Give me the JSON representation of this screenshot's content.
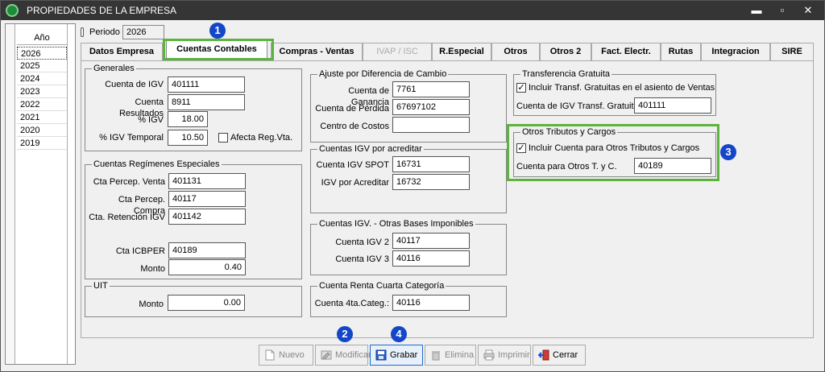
{
  "window": {
    "title": "PROPIEDADES DE LA EMPRESA",
    "min": "▬",
    "max": "▫",
    "close": "✕"
  },
  "years": {
    "header": "Año",
    "items": [
      "2026",
      "2025",
      "2024",
      "2023",
      "2022",
      "2021",
      "2020",
      "2019"
    ],
    "selected": "2026"
  },
  "period": {
    "label": "Periodo",
    "value": "2026"
  },
  "tabs": [
    "Datos Empresa",
    "Cuentas Contables",
    "Compras - Ventas",
    "IVAP / ISC",
    "R.Especial",
    "Otros",
    "Otros 2",
    "Fact. Electr.",
    "Rutas",
    "Integracion",
    "SIRE"
  ],
  "generales": {
    "title": "Generales",
    "cuenta_igv_label": "Cuenta de IGV",
    "cuenta_igv": "401111",
    "cuenta_res_label": "Cuenta Resultados",
    "cuenta_res": "8911",
    "pct_igv_label": "% IGV",
    "pct_igv": "18.00",
    "pct_igv_temp_label": "% IGV Temporal",
    "pct_igv_temp": "10.50",
    "afecta_label": "Afecta Reg.Vta."
  },
  "especiales": {
    "title": "Cuentas Regímenes Especiales",
    "percep_venta_label": "Cta Percep. Venta",
    "percep_venta": "401131",
    "percep_compra_label": "Cta Percep. Compra",
    "percep_compra": "40117",
    "retencion_label": "Cta. Retención IGV",
    "retencion": "401142",
    "icbper_label": "Cta ICBPER",
    "icbper": "40189",
    "monto_label": "Monto",
    "monto": "0.40"
  },
  "uit": {
    "title": "UIT",
    "monto_label": "Monto",
    "monto": "0.00"
  },
  "ajuste": {
    "title": "Ajuste por Diferencia de Cambio",
    "ganancia_label": "Cuenta de Ganancia",
    "ganancia": "7761",
    "perdida_label": "Cuenta de Pérdida",
    "perdida": "67697102",
    "costos_label": "Centro de Costos",
    "costos": ""
  },
  "igv_acreditar": {
    "title": "Cuentas IGV por acreditar",
    "spot_label": "Cuenta IGV SPOT",
    "spot": "16731",
    "acreditar_label": "IGV por Acreditar",
    "acreditar": "16732"
  },
  "otras_bases": {
    "title": "Cuentas IGV. - Otras Bases Imponibles",
    "igv2_label": "Cuenta IGV 2",
    "igv2": "40117",
    "igv3_label": "Cuenta IGV 3",
    "igv3": "40116"
  },
  "renta_cuarta": {
    "title": "Cuenta Renta Cuarta Categoría",
    "cuenta_label": "Cuenta 4ta.Categ.:",
    "cuenta": "40116"
  },
  "transferencia": {
    "title": "Transferencia Gratuita",
    "check_label": "Incluir Transf. Gratuitas en el asiento de Ventas",
    "checked": "✓",
    "cuenta_label": "Cuenta de IGV Transf. Gratuita",
    "cuenta": "401111"
  },
  "otros_tributos": {
    "title": "Otros Tributos y Cargos",
    "check_label": "Incluir Cuenta para Otros Tributos y Cargos",
    "checked": "✓",
    "cuenta_label": "Cuenta para Otros T. y C.",
    "cuenta": "40189"
  },
  "badges": [
    "1",
    "2",
    "3",
    "4"
  ],
  "buttons": {
    "nuevo": "Nuevo",
    "modificar": "Modificar",
    "grabar": "Grabar",
    "elimina": "Elimina",
    "imprimir": "Imprimir",
    "cerrar": "Cerrar"
  }
}
